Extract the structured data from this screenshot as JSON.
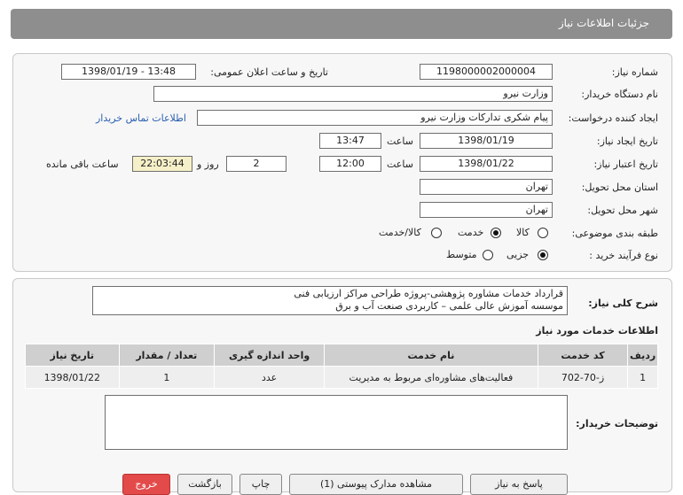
{
  "header": {
    "title": "جزئیات اطلاعات نیاز"
  },
  "form": {
    "need_number_label": "شماره نیاز:",
    "need_number": "1198000002000004",
    "announce_label": "تاریخ و ساعت اعلان عمومی:",
    "announce_value": "1398/01/19 - 13:48",
    "buyer_org_label": "نام دستگاه خریدار:",
    "buyer_org": "وزارت نیرو",
    "requester_label": "ایجاد کننده درخواست:",
    "requester": "پیام شکری تدارکات وزارت نیرو",
    "contact_link": "اطلاعات تماس خریدار",
    "created_label": "تاریخ ایجاد نیاز:",
    "created_date": "1398/01/19",
    "time_label": "ساعت",
    "created_time": "13:47",
    "validity_label": "تاریخ اعتبار نیاز:",
    "validity_date": "1398/01/22",
    "validity_time": "12:00",
    "days": "2",
    "days_label": "روز و",
    "remaining": "22:03:44",
    "remaining_label": "ساعت باقی مانده",
    "province_label": "استان محل تحویل:",
    "province": "تهران",
    "city_label": "شهر محل تحویل:",
    "city": "تهران",
    "category_label": "طبقه بندی موضوعی:",
    "category_options": [
      "کالا",
      "خدمت",
      "کالا/خدمت"
    ],
    "category_selected": "خدمت",
    "process_label": "نوع فرآیند خرید :",
    "process_options": [
      "جزیی",
      "متوسط"
    ],
    "process_selected": "جزیی"
  },
  "summary": {
    "label": "شرح کلی نیاز:",
    "line1": "قرارداد خدمات مشاوره پژوهشی-پروژه طراحی مراکز ارزیابی فنی",
    "line2": "موسسه آموزش عالی علمی – کاربردی صنعت آب و برق"
  },
  "services": {
    "title": "اطلاعات خدمات مورد نیاز",
    "columns": [
      "ردیف",
      "کد خدمت",
      "نام خدمت",
      "واحد اندازه گیری",
      "تعداد / مقدار",
      "تاریخ نیاز"
    ],
    "rows": [
      [
        "1",
        "ز-70-702",
        "فعالیت‌های مشاوره‌ای مربوط به مدیریت",
        "عدد",
        "1",
        "1398/01/22"
      ]
    ]
  },
  "buyer_notes_label": "توضیحات خریدار:",
  "buttons": {
    "reply": "پاسخ به نیاز",
    "view_docs": "مشاهده مدارک پیوستی (1)",
    "print": "چاپ",
    "back": "بازگشت",
    "exit": "خروج"
  },
  "colors": {
    "header": "#8e8e8e",
    "accent_link": "#2a5fb0",
    "exit_button": "#e34a4a"
  }
}
